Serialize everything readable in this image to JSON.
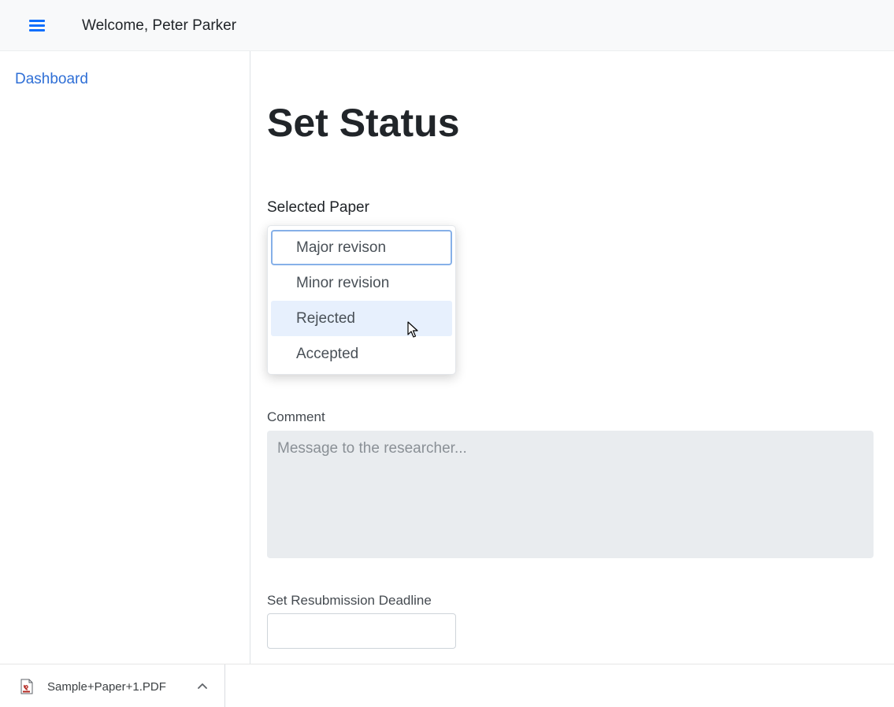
{
  "header": {
    "menu_icon": "hamburger-menu-icon",
    "welcome_text": "Welcome, Peter Parker"
  },
  "sidebar": {
    "items": [
      {
        "label": "Dashboard"
      }
    ]
  },
  "main": {
    "title": "Set Status",
    "selected_paper_label": "Selected Paper",
    "status_dropdown": {
      "options": [
        {
          "label": "Major revison",
          "state": "focused"
        },
        {
          "label": "Minor revision",
          "state": ""
        },
        {
          "label": "Rejected",
          "state": "hover"
        },
        {
          "label": "Accepted",
          "state": ""
        }
      ]
    },
    "comment": {
      "label": "Comment",
      "placeholder": "Message to the researcher...",
      "value": ""
    },
    "deadline": {
      "label": "Set Resubmission Deadline",
      "value": ""
    }
  },
  "downloads": {
    "items": [
      {
        "filename": "Sample+Paper+1.PDF",
        "icon": "pdf-file-icon"
      }
    ],
    "expand_icon": "chevron-up-icon"
  },
  "colors": {
    "accent": "#0d6efd",
    "link": "#2f6fd6",
    "hover_bg": "#e7f0fd",
    "focus_border": "#86b0e8",
    "textarea_bg": "#e9ecef"
  }
}
